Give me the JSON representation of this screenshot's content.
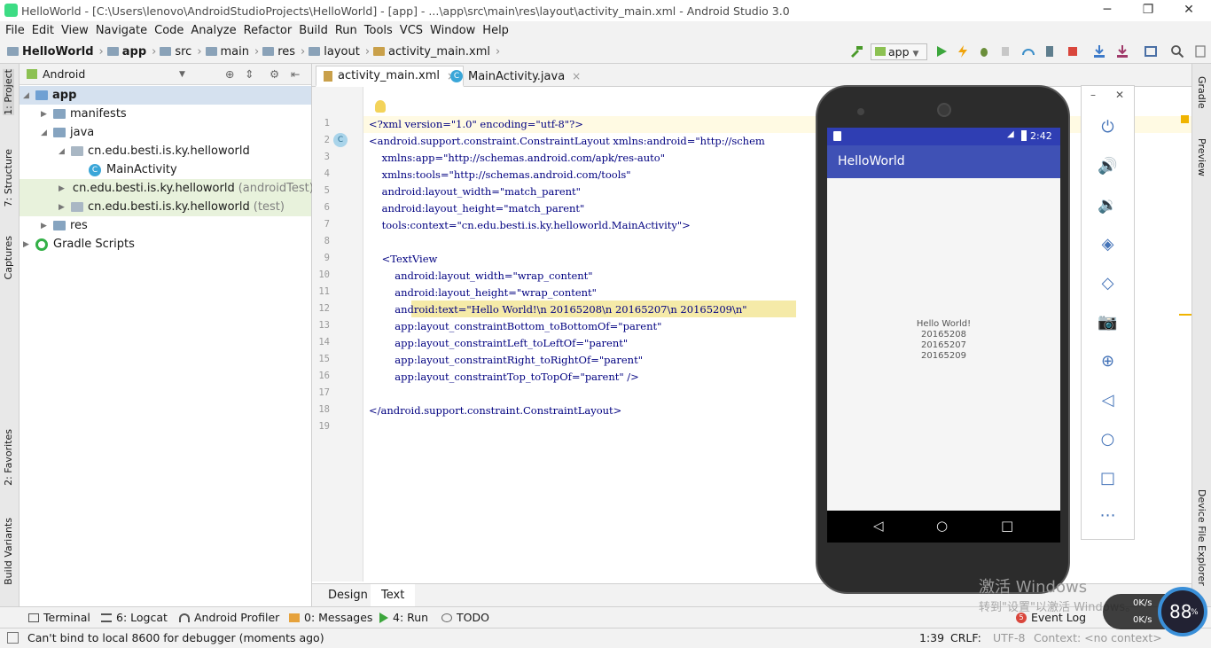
{
  "window": {
    "title": "HelloWorld - [C:\\Users\\lenovo\\AndroidStudioProjects\\HelloWorld] - [app] - ...\\app\\src\\main\\res\\layout\\activity_main.xml - Android Studio 3.0",
    "minimize": "─",
    "restore": "❐",
    "close": "✕"
  },
  "menu": [
    "File",
    "Edit",
    "View",
    "Navigate",
    "Code",
    "Analyze",
    "Refactor",
    "Build",
    "Run",
    "Tools",
    "VCS",
    "Window",
    "Help"
  ],
  "breadcrumbs": [
    "HelloWorld",
    "app",
    "src",
    "main",
    "res",
    "layout",
    "activity_main.xml"
  ],
  "toolbar": {
    "run_config": "app"
  },
  "left_tools": [
    "1: Project",
    "7: Structure",
    "Captures",
    "2: Favorites",
    "Build Variants"
  ],
  "right_tools": [
    "Gradle",
    "Preview",
    "Device File Explorer"
  ],
  "project": {
    "view_mode": "Android",
    "tree": [
      {
        "label": "app",
        "suffix": ""
      },
      {
        "label": "manifests",
        "suffix": ""
      },
      {
        "label": "java",
        "suffix": ""
      },
      {
        "label": "cn.edu.besti.is.ky.helloworld",
        "suffix": ""
      },
      {
        "label": "MainActivity",
        "suffix": ""
      },
      {
        "label": "cn.edu.besti.is.ky.helloworld",
        "suffix": "(androidTest)"
      },
      {
        "label": "cn.edu.besti.is.ky.helloworld",
        "suffix": "(test)"
      },
      {
        "label": "res",
        "suffix": ""
      },
      {
        "label": "Gradle Scripts",
        "suffix": ""
      }
    ]
  },
  "editor": {
    "tabs": [
      "activity_main.xml",
      "MainActivity.java"
    ],
    "line_numbers": [
      "1",
      "2",
      "3",
      "4",
      "5",
      "6",
      "7",
      "8",
      "9",
      "10",
      "11",
      "12",
      "13",
      "14",
      "15",
      "16",
      "17",
      "18",
      "19"
    ],
    "lines": [
      "<?xml version=\"1.0\" encoding=\"utf-8\"?>",
      "<android.support.constraint.ConstraintLayout xmlns:android=\"http://schem",
      "    xmlns:app=\"http://schemas.android.com/apk/res-auto\"",
      "    xmlns:tools=\"http://schemas.android.com/tools\"",
      "    android:layout_width=\"match_parent\"",
      "    android:layout_height=\"match_parent\"",
      "    tools:context=\"cn.edu.besti.is.ky.helloworld.MainActivity\">",
      "",
      "    <TextView",
      "        android:layout_width=\"wrap_content\"",
      "        android:layout_height=\"wrap_content\"",
      "        android:text=\"Hello World!\\n 20165208\\n 20165207\\n 20165209\\n\"",
      "        app:layout_constraintBottom_toBottomOf=\"parent\"",
      "        app:layout_constraintLeft_toLeftOf=\"parent\"",
      "        app:layout_constraintRight_toRightOf=\"parent\"",
      "        app:layout_constraintTop_toTopOf=\"parent\" />",
      "",
      "</android.support.constraint.ConstraintLayout>",
      ""
    ],
    "bottom_tabs": [
      "Design",
      "Text"
    ]
  },
  "emulator": {
    "time": "2:42",
    "app_title": "HelloWorld",
    "screen_text": "Hello World!\n20165208\n20165207\n20165209",
    "panel_close": "✕",
    "panel_minimize": "–"
  },
  "tool_windows": [
    "Terminal",
    "6: Logcat",
    "Android Profiler",
    "0: Messages",
    "4: Run",
    "TODO",
    "Event Log"
  ],
  "event_log_count": "5",
  "status": {
    "message": "Can't bind to local 8600 for debugger (moments ago)",
    "position": "1:39",
    "line_sep": "CRLF:",
    "encoding": "UTF-8",
    "context": "Context: <no context>"
  },
  "overlay": {
    "watermark_line1": "激活 Windows",
    "watermark_line2": "转到\"设置\"以激活 Windows。",
    "net_up": "0K/s",
    "net_down": "0K/s",
    "meter_value": "88",
    "meter_unit": "%"
  }
}
